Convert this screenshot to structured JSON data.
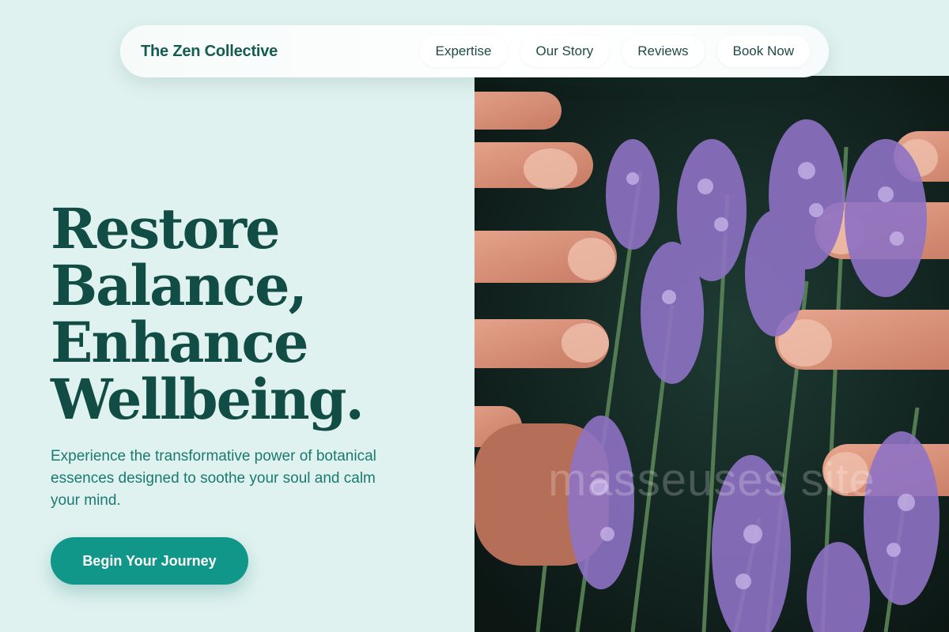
{
  "brand": {
    "name": "The Zen Collective"
  },
  "nav": {
    "items": [
      {
        "label": "Expertise"
      },
      {
        "label": "Our Story"
      },
      {
        "label": "Reviews"
      },
      {
        "label": "Book Now"
      }
    ]
  },
  "hero": {
    "title_lines": [
      "Restore",
      "Balance,",
      "Enhance",
      "Wellbeing."
    ],
    "subtitle": "Experience the transformative power of botanical essences designed to soothe your soul and calm your mind.",
    "cta_label": "Begin Your Journey",
    "image_watermark": "masseuses site"
  },
  "colors": {
    "page_background": "#e0f2f0",
    "brand_teal": "#145c52",
    "heading": "#124d45",
    "subtitle": "#1a7a6f",
    "cta_background": "#11968a",
    "lavender": "#9b7fcf"
  }
}
